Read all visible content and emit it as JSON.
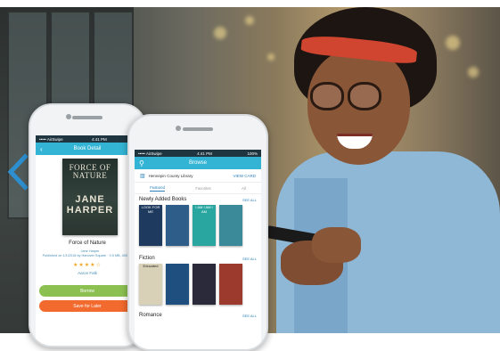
{
  "phone_left": {
    "status": {
      "carrier": "••••• AirSwipe",
      "time": "4:41 PM",
      "battery": ""
    },
    "header_title": "Book Detail",
    "book": {
      "cover_title": "FORCE OF NATURE",
      "cover_author": "JANE HARPER",
      "title": "Force of Nature",
      "author": "Jane Harper",
      "meta": "Published on 1/1/2018 by Hanover Square · 3.5 MB, 400 pages",
      "rating": "★★★★☆",
      "series": "Aaron Falk"
    },
    "buttons": {
      "borrow": "Borrow",
      "save_later": "Save for Later"
    }
  },
  "phone_right": {
    "status": {
      "carrier": "••••• AirSwipe",
      "time": "4:41 PM",
      "battery": "100%"
    },
    "header_title": "Browse",
    "library": {
      "name": "Hennepin County Library",
      "view_link": "VIEW CARD"
    },
    "tabs": [
      "Featured",
      "Favorites",
      "All"
    ],
    "sections": [
      {
        "title": "Newly Added Books",
        "see_all": "SEE ALL",
        "covers": [
          {
            "text": "LOOK FOR ME",
            "color": "#1f3a5f"
          },
          {
            "text": "",
            "color": "#2f5d8a"
          },
          {
            "text": "I AM I AM I AM",
            "color": "#2aa6a1"
          },
          {
            "text": "",
            "color": "#3a8a9a"
          }
        ]
      },
      {
        "title": "Fiction",
        "see_all": "SEE ALL",
        "covers": [
          {
            "text": "Educated",
            "color": "#d9d0b8"
          },
          {
            "text": "",
            "color": "#1f4f7f"
          },
          {
            "text": "",
            "color": "#2a2a3a"
          },
          {
            "text": "",
            "color": "#9c3a2e"
          }
        ]
      },
      {
        "title": "Romance",
        "see_all": "SEE ALL",
        "covers": []
      }
    ]
  },
  "nav": {
    "prev_icon": "chevron-left-icon",
    "color": "#2d8fd0"
  }
}
